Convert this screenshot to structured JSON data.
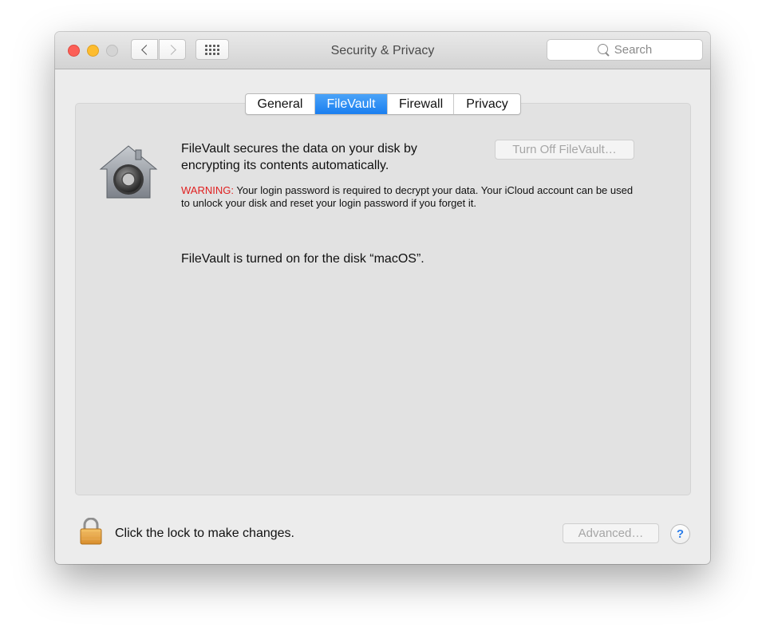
{
  "window": {
    "title": "Security & Privacy",
    "search_placeholder": "Search"
  },
  "tabs": [
    {
      "label": "General",
      "active": false
    },
    {
      "label": "FileVault",
      "active": true
    },
    {
      "label": "Firewall",
      "active": false
    },
    {
      "label": "Privacy",
      "active": false
    }
  ],
  "filevault": {
    "description": "FileVault secures the data on your disk by encrypting its contents automatically.",
    "turn_off_label": "Turn Off FileVault…",
    "warning_label": "WARNING:",
    "warning_text": "Your login password is required to decrypt your data. Your iCloud account can be used to unlock your disk and reset your login password if you forget it.",
    "status": "FileVault is turned on for the disk “macOS”."
  },
  "footer": {
    "lock_text": "Click the lock to make changes.",
    "advanced_label": "Advanced…",
    "help_label": "?"
  },
  "colors": {
    "accent": "#1a7ff0",
    "warning": "#e02020",
    "close": "#fc5f57",
    "minimize": "#fdbc2e",
    "disabled_text": "#a6a6a6"
  },
  "icons": {
    "house": "filevault-house-icon",
    "lock": "padlock-icon"
  }
}
